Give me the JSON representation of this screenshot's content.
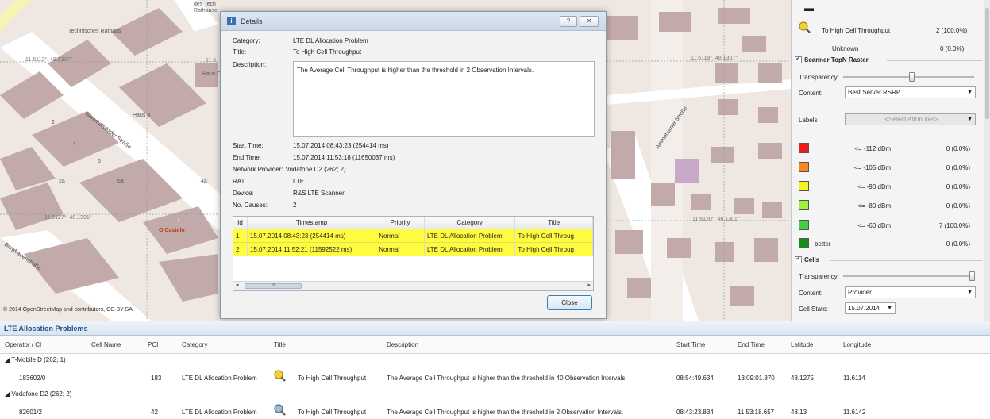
{
  "map": {
    "copyright": "© 2014 OpenStreetMap and contributors, CC-BY-SA",
    "place_labels": [
      "Technisches Rathaus",
      "O Castelo",
      "Haus 3",
      "Haus C"
    ],
    "streets": [
      "Gammelsdorfer Straße",
      "Burgfrauenstraße",
      "Ammeburner Straße"
    ],
    "coords": [
      "11.6112°, 48.1307°",
      "11.6118°, 48.1307°",
      "11.6127°, 48.1301°",
      "11.6120°, 48.1301°"
    ],
    "fragments": [
      "des Tech",
      "Rathause",
      "11.6"
    ],
    "roof_labels": [
      "2",
      "4",
      "6",
      "2a",
      "6a",
      "4a"
    ]
  },
  "dialog": {
    "title": "Details",
    "help_btn": "?",
    "close_x": "✕",
    "fields": {
      "category_label": "Category:",
      "category": "LTE DL Allocation Problem",
      "title_label": "Title:",
      "title": "To High Cell Throughput",
      "description_label": "Description:",
      "description": "The Average Cell Throughput is higher than the threshold in 2 Observation Intervals.",
      "start_label": "Start Time:",
      "start": "15.07.2014 08:43:23 (254414 ms)",
      "end_label": "End Time:",
      "end": "15.07.2014 11:53:18 (11650037 ms)",
      "provider_label": "Network Provider:",
      "provider": "Vodafone D2 (262; 2)",
      "rat_label": "RAT:",
      "rat": "LTE",
      "device_label": "Device:",
      "device": "R&S LTE Scanner",
      "causes_label": "No. Causes:",
      "causes": "2"
    },
    "table": {
      "columns": [
        "Id",
        "Timestamp",
        "Priority",
        "Category",
        "Title"
      ],
      "rows": [
        [
          "1",
          "15.07.2014 08:43:23 (254414 ms)",
          "Normal",
          "LTE DL Allocation Problem",
          "To High Cell Throug"
        ],
        [
          "2",
          "15.07.2014 11:52:21 (11592522 ms)",
          "Normal",
          "LTE DL Allocation Problem",
          "To High Cell Throug"
        ]
      ],
      "scroll_thumb": "III"
    },
    "close_button": "Close"
  },
  "panel": {
    "top_item": "To High Cell Throughput",
    "top_item_val": "2 (100.0%)",
    "unknown": "Unknown",
    "unknown_val": "0 (0.0%)",
    "raster_head": "Scanner TopN Raster",
    "transparency": "Transparency:",
    "content": "Content:",
    "content_val": "Best Server RSRP",
    "labels": "Labels",
    "labels_val": "<Select Attributes>",
    "legend": [
      {
        "color": "#f21b1b",
        "label": "<= -112 dBm",
        "val": "0 (0.0%)"
      },
      {
        "color": "#f7861f",
        "label": "<= -105 dBm",
        "val": "0 (0.0%)"
      },
      {
        "color": "#f5f51c",
        "label": "<= -90 dBm",
        "val": "0 (0.0%)"
      },
      {
        "color": "#9ef03a",
        "label": "<= -80 dBm",
        "val": "0 (0.0%)"
      },
      {
        "color": "#3fd13f",
        "label": "<= -60 dBm",
        "val": "7 (100.0%)"
      },
      {
        "color": "#1c8a1c",
        "label": "better",
        "val": "0 (0.0%)"
      }
    ],
    "cells_head": "Cells",
    "cells_transparency": "Transparency:",
    "cells_content": "Content:",
    "cells_content_val": "Provider",
    "cell_state": "Cell State:",
    "cell_state_val": "15.07.2014"
  },
  "bottom": {
    "title": "LTE Allocation Problems",
    "columns": [
      "Operator / CI",
      "Cell Name",
      "PCI",
      "Category",
      "Title",
      "Description",
      "Start Time",
      "End Time",
      "Latitude",
      "Longitude"
    ],
    "groups": [
      {
        "name": "T-Mobile D (262; 1)",
        "row": {
          "ci": "183602/0",
          "pci": "183",
          "category": "LTE DL Allocation Problem",
          "title": "To High Cell Throughput",
          "description": "The Average Cell Throughput is higher than the threshold in 40 Observation Intervals.",
          "start": "08:54:49.634",
          "end": "13:09:01.870",
          "lat": "48.1275",
          "lon": "11.6114"
        }
      },
      {
        "name": "Vodafone D2 (262; 2)",
        "row": {
          "ci": "82601/2",
          "pci": "42",
          "category": "LTE DL Allocation Problem",
          "title": "To High Cell Throughput",
          "description": "The Average Cell Throughput is higher than the threshold in 2 Observation Intervals.",
          "start": "08:43:23.834",
          "end": "11:53:18.657",
          "lat": "48.13",
          "lon": "11.6142"
        }
      }
    ]
  }
}
